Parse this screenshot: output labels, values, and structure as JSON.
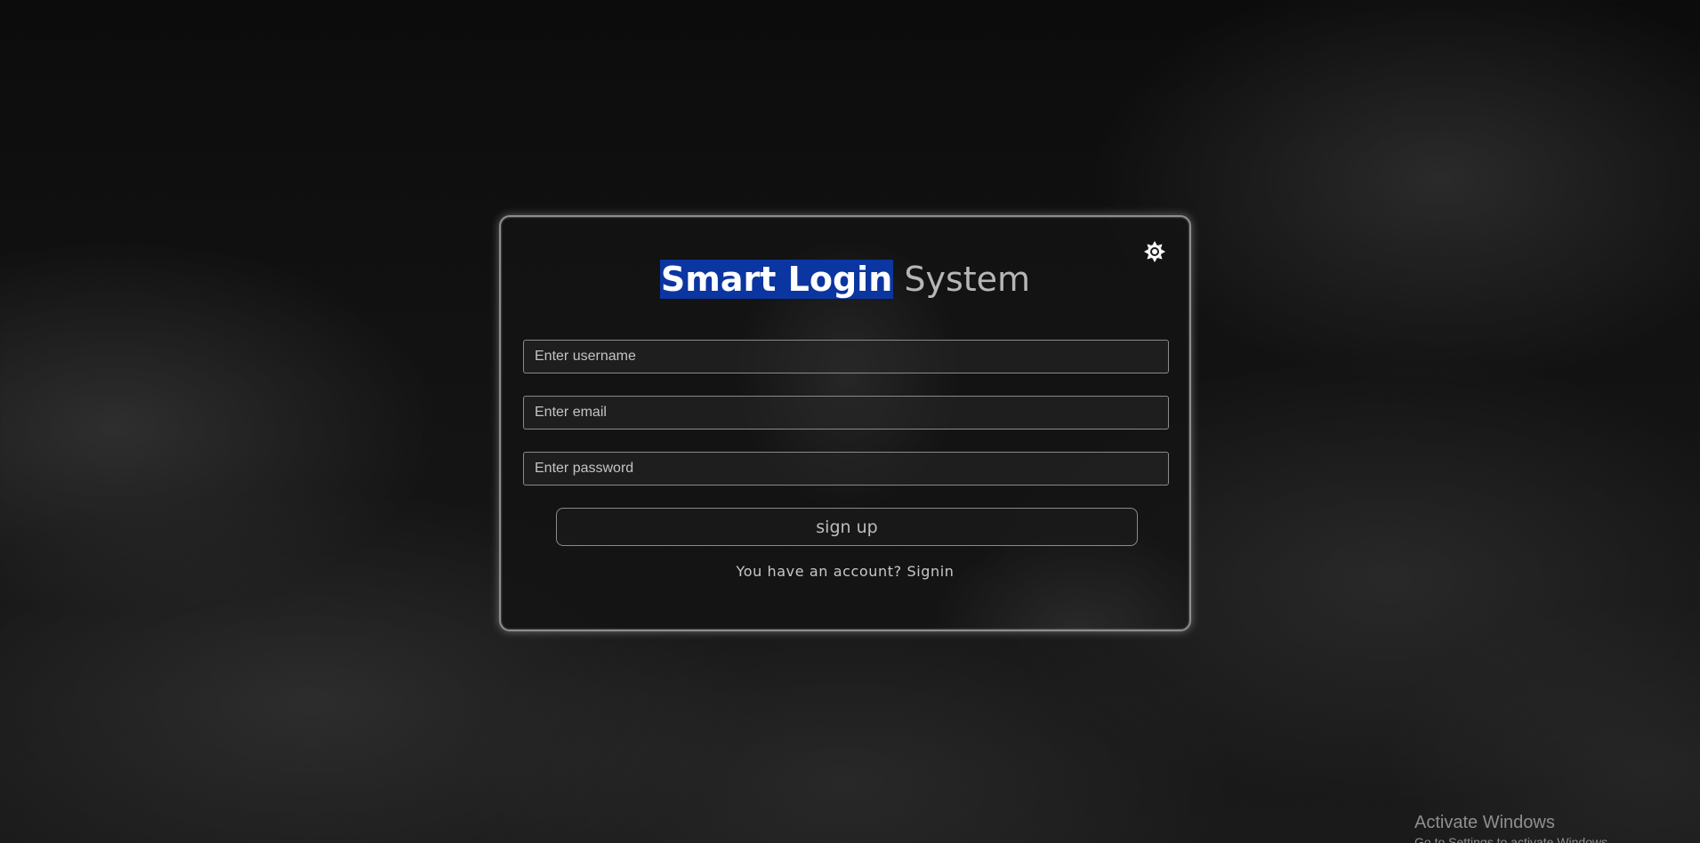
{
  "header": {
    "title_highlight": "Smart Login",
    "title_rest": "System",
    "highlight_color": "#0b36a1",
    "theme_toggle_icon": "sun-icon"
  },
  "form": {
    "username": {
      "value": "",
      "placeholder": "Enter username"
    },
    "email": {
      "value": "",
      "placeholder": "Enter email"
    },
    "password": {
      "value": "",
      "placeholder": "Enter password"
    },
    "submit_label": "sign up",
    "account_prompt": "You have an account?",
    "signin_label": "Signin"
  },
  "watermark": {
    "title": "Activate Windows",
    "subtitle": "Go to Settings to activate Windows."
  }
}
